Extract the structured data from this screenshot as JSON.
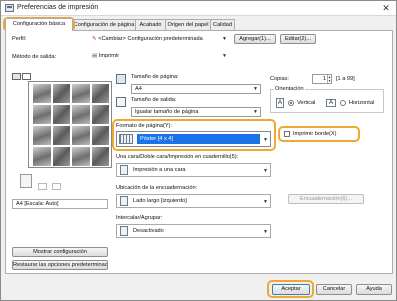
{
  "window": {
    "title": "Preferencias de impresión",
    "close_glyph": "✕"
  },
  "tabs": [
    {
      "label": "Configuración básica"
    },
    {
      "label": "Configuración de página"
    },
    {
      "label": "Acabado"
    },
    {
      "label": "Origen del papel"
    },
    {
      "label": "Calidad"
    }
  ],
  "profile": {
    "label": "Perfil:",
    "value": "<Cambiar> Configuración predeterminada",
    "add_button": "Agregar(1)...",
    "edit_button": "Editar(2)..."
  },
  "output_method": {
    "label": "Método de salida:",
    "value": "Imprimir"
  },
  "page_size": {
    "label": "Tamaño de página:",
    "value": "A4"
  },
  "output_size": {
    "label": "Tamaño de salida:",
    "value": "Igualar tamaño de página"
  },
  "copies": {
    "label": "Copias:",
    "value": "1",
    "range": "[1 a 99]"
  },
  "orientation": {
    "label": "Orientación",
    "vertical": "Vertical",
    "horizontal": "Horizontal",
    "glyph": "A",
    "selected": "vertical"
  },
  "page_layout": {
    "label": "Formato de página(Y):",
    "value": "Póster [4 x 4]",
    "print_border_label": "Imprimir borde(X)"
  },
  "duplex": {
    "label": "Una cara/Doble cara/Impresión en cuadernillo(5):",
    "value": "Impresión a una cara"
  },
  "binding": {
    "label": "Ubicación de la encuadernación:",
    "value": "Lado largo [izquierdo]",
    "button": "Encuadernación(6)..."
  },
  "collate": {
    "label": "Intercalar/Agrupar:",
    "value": "Desactivado"
  },
  "preview": {
    "caption": "A4 [Escala: Auto]",
    "show_settings_button": "Mostrar configuración",
    "restore_defaults_button": "Restaurar las opciones predeterminadas"
  },
  "footer": {
    "ok": "Aceptar",
    "cancel": "Cancelar",
    "help": "Ayuda"
  },
  "colors": {
    "highlight": "#f0a830",
    "selection": "#1a73e8"
  }
}
